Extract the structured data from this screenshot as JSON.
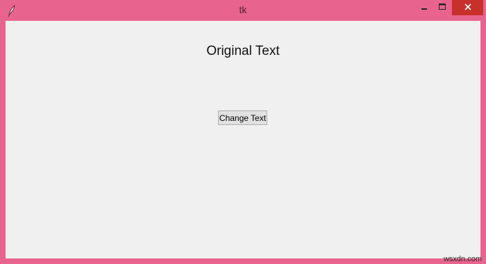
{
  "window": {
    "title": "tk",
    "frame_color": "#e8648e",
    "close_button_color": "#c7302b",
    "icons": {
      "app": "feather-icon",
      "minimize": "minimize-icon",
      "maximize": "maximize-icon",
      "close": "close-icon"
    }
  },
  "main": {
    "label_text": "Original Text",
    "button_label": "Change Text"
  },
  "watermark": {
    "text": "wsxdn.com"
  }
}
